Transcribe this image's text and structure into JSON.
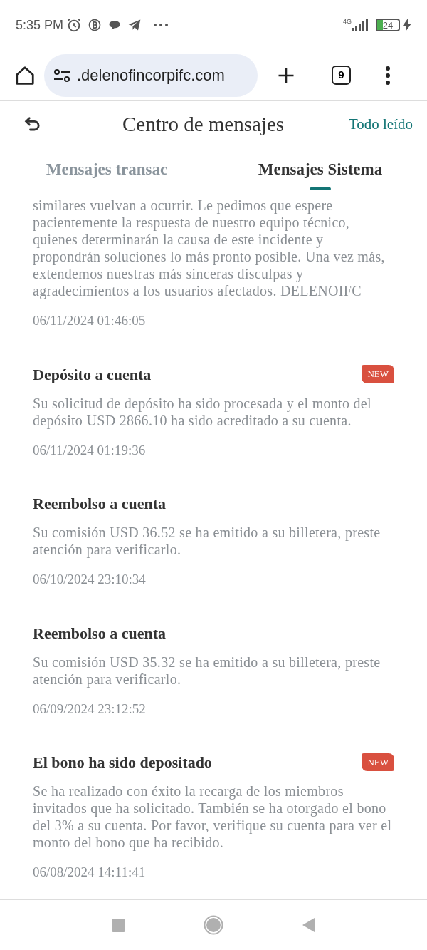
{
  "status_bar": {
    "time": "5:35 PM",
    "network": "4G",
    "battery": "24"
  },
  "browser": {
    "url": ".delenofincorpifc.com",
    "tab_count": "9"
  },
  "header": {
    "title": "Centro de mensajes",
    "action": "Todo leído"
  },
  "tabs": [
    {
      "label": "Mensajes transac",
      "selected": false
    },
    {
      "label": "Mensajes Sistema",
      "selected": true
    }
  ],
  "messages": [
    {
      "body": "similares vuelvan a ocurrir. Le pedimos que espere pacientemente la respuesta de nuestro equipo técnico, quienes determinarán la causa de este incidente y propondrán soluciones lo más pronto posible. Una vez más, extendemos nuestras más sinceras disculpas y agradecimientos a los usuarios afectados. DELENOIFC",
      "date": "06/11/2024 01:46:05"
    },
    {
      "title": "Depósito a cuenta",
      "badge": "NEW",
      "body": "Su solicitud de depósito ha sido procesada y el monto del depósito USD 2866.10 ha sido acreditado a su cuenta.",
      "date": "06/11/2024 01:19:36"
    },
    {
      "title": "Reembolso a cuenta",
      "body": "Su comisión USD 36.52 se ha emitido a su billetera, preste atención para verificarlo.",
      "date": "06/10/2024 23:10:34"
    },
    {
      "title": "Reembolso a cuenta",
      "body": "Su comisión USD 35.32 se ha emitido a su billetera, preste atención para verificarlo.",
      "date": "06/09/2024 23:12:52"
    },
    {
      "title": "El bono ha sido depositado",
      "badge": "NEW",
      "body": "Se ha realizado con éxito la recarga de los miembros invitados que ha solicitado. También se ha otorgado el bono del 3% a su cuenta. Por favor, verifique su cuenta para ver el monto del bono que ha recibido.",
      "date": "06/08/2024 14:11:41"
    }
  ]
}
